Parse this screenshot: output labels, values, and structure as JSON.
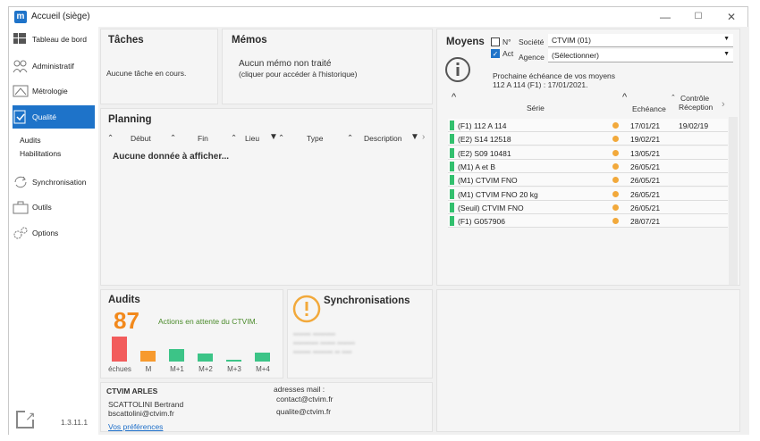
{
  "window": {
    "title": "Accueil (siège)",
    "app_icon": "m"
  },
  "controls": {
    "minimize": "—",
    "maximize": "☐",
    "close": "✕"
  },
  "sidebar": {
    "items": [
      {
        "label": "Tableau de bord"
      },
      {
        "label": "Administratif"
      },
      {
        "label": "Métrologie"
      },
      {
        "label": "Qualité"
      },
      {
        "label": "Synchronisation"
      },
      {
        "label": "Outils"
      },
      {
        "label": "Options"
      }
    ],
    "subitems": [
      {
        "label": "Audits"
      },
      {
        "label": "Habilitations"
      }
    ],
    "version": "1.3.11.1"
  },
  "taches": {
    "title": "Tâches",
    "text": "Aucune tâche en cours."
  },
  "memos": {
    "title": "Mémos",
    "line1": "Aucun mémo non traité",
    "line2": "(cliquer pour accéder à l'historique)"
  },
  "planning": {
    "title": "Planning",
    "columns": [
      "Début",
      "Fin",
      "Lieu",
      "Type",
      "Description"
    ],
    "empty": "Aucune donnée à afficher..."
  },
  "moyens": {
    "title": "Moyens",
    "cb_n_label": "N°",
    "cb_act_label": "Act",
    "societe_label": "Société",
    "societe_value": "CTVIM (01)",
    "agence_label": "Agence",
    "agence_value": "(Sélectionner)",
    "notice1": "Prochaine échéance de vos moyens",
    "notice2": "112 A 114 (F1) : 17/01/2021.",
    "col_serie": "Série",
    "col_echeance": "Echéance",
    "col_controle1": "Contrôle",
    "col_controle2": "Réception",
    "rows": [
      {
        "serie": "(F1) 112 A 114",
        "echeance": "17/01/21",
        "reception": "19/02/19"
      },
      {
        "serie": "(E2) S14 12518",
        "echeance": "19/02/21",
        "reception": ""
      },
      {
        "serie": "(E2) S09 10481",
        "echeance": "13/05/21",
        "reception": ""
      },
      {
        "serie": "(M1) A et B",
        "echeance": "26/05/21",
        "reception": ""
      },
      {
        "serie": "(M1) CTVIM FNO",
        "echeance": "26/05/21",
        "reception": ""
      },
      {
        "serie": "(M1) CTVIM FNO 20 kg",
        "echeance": "26/05/21",
        "reception": ""
      },
      {
        "serie": "(Seuil) CTVIM FNO",
        "echeance": "26/05/21",
        "reception": ""
      },
      {
        "serie": "(F1) G057906",
        "echeance": "28/07/21",
        "reception": ""
      }
    ]
  },
  "audits": {
    "title": "Audits",
    "count": "87",
    "caption": "Actions en attente du CTVIM.",
    "chart_data": {
      "type": "bar",
      "categories": [
        "échues",
        "M",
        "M+1",
        "M+2",
        "M+3",
        "M+4"
      ],
      "values": [
        26,
        11,
        13,
        8,
        2,
        9
      ],
      "colors": [
        "#f25c5c",
        "#f79a2e",
        "#3cc487",
        "#3cc487",
        "#3cc487",
        "#3cc487"
      ]
    }
  },
  "sync": {
    "title": "Synchronisations"
  },
  "footer": {
    "org": "CTVIM  ARLES",
    "user_name": "SCATTOLINI Bertrand",
    "user_email": "bscattolini@ctvim.fr",
    "prefs_link": "Vos préférences",
    "mail_label": "adresses mail :",
    "mail1": "contact@ctvim.fr",
    "mail2": "qualite@ctvim.fr"
  }
}
